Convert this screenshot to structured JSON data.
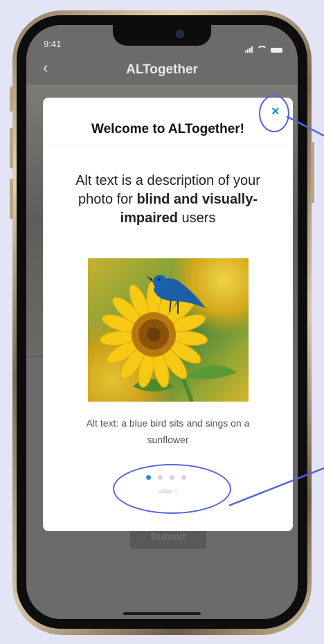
{
  "status_bar": {
    "time": "9:41"
  },
  "nav": {
    "back_glyph": "‹",
    "title": "ALTogether"
  },
  "background_form": {
    "submit_label": "Submit"
  },
  "modal": {
    "close_glyph": "×",
    "title": "Welcome to ALTogether!",
    "description_parts": {
      "p1": "Alt text is a description of your photo for ",
      "bold": "blind and visually-impaired",
      "p2": " users"
    },
    "caption": "Alt text: a blue bird sits and sings on a sunflower",
    "pager": {
      "total": 4,
      "active": 1
    },
    "swipe_hint": "swipe >"
  },
  "colors": {
    "accent": "#1e8ce6",
    "annotation": "#5463e0",
    "page_background": "#e3e5f7"
  },
  "icons": [
    "back-icon",
    "close-icon",
    "signal-icon",
    "wifi-icon",
    "battery-icon"
  ]
}
